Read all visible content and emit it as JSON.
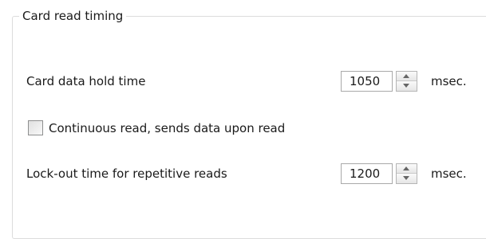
{
  "group": {
    "title": "Card read timing"
  },
  "hold_time": {
    "label": "Card data hold time",
    "value": "1050",
    "unit": "msec."
  },
  "continuous_read": {
    "label": "Continuous read, sends data upon read",
    "checked": false
  },
  "lockout_time": {
    "label": "Lock-out time for repetitive reads",
    "value": "1200",
    "unit": "msec."
  },
  "icons": {
    "spin_up": "chevron-up-icon",
    "spin_down": "chevron-down-icon"
  },
  "colors": {
    "background": "#ffffff",
    "border": "#dcdcdc",
    "text": "#1a1a1a"
  }
}
